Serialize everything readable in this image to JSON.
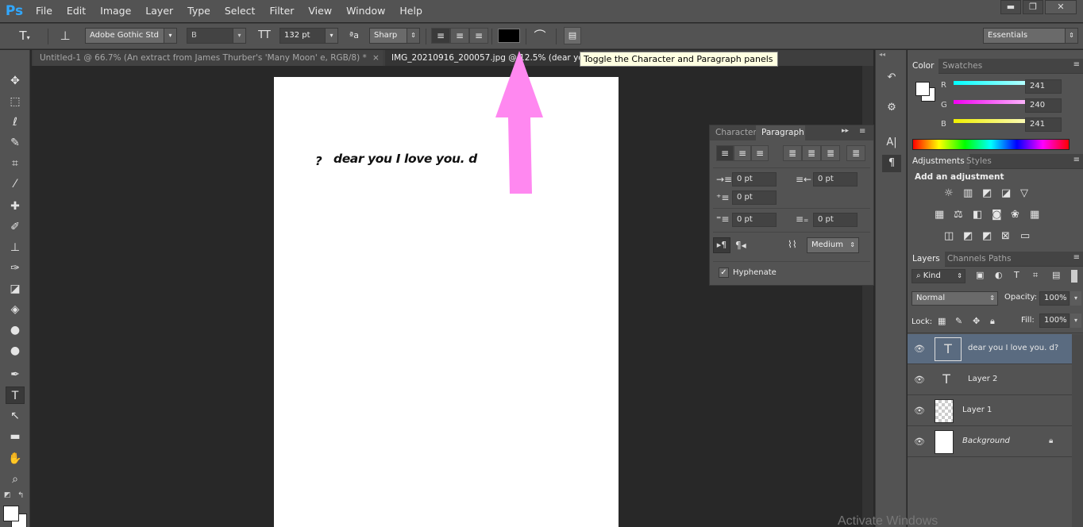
{
  "app": {
    "logo": "Ps"
  },
  "menu": [
    "File",
    "Edit",
    "Image",
    "Layer",
    "Type",
    "Select",
    "Filter",
    "View",
    "Window",
    "Help"
  ],
  "window_controls": {
    "minimize": "▬",
    "restore": "❐",
    "close": "✕"
  },
  "options_bar": {
    "font_family": "Adobe Gothic Std",
    "font_style": "B",
    "font_size": "132 pt",
    "anti_alias": "Sharp",
    "text_color": "#000000",
    "workspace": "Essentials"
  },
  "tabs": [
    {
      "label": "Untitled-1 @ 66.7% (An extract from James Thurber's 'Many Moon' e, RGB/8) *",
      "close": "×"
    },
    {
      "label": "IMG_20210916_200057.jpg @ 12.5% (dear you",
      "close": ""
    }
  ],
  "tooltip": "Toggle the Character and Paragraph panels",
  "document": {
    "text": "dear you I love you. d",
    "mark": "?"
  },
  "paragraph_panel": {
    "tabs": [
      "Character",
      "Paragraph"
    ],
    "indent_left": "0 pt",
    "indent_right": "0 pt",
    "indent_first": "0 pt",
    "space_before": "0 pt",
    "space_after": "0 pt",
    "composer": "Medium",
    "hyphenate_label": "Hyphenate",
    "hyphenate_checked": true
  },
  "color_panel": {
    "tabs": [
      "Color",
      "Swatches"
    ],
    "labels": [
      "R",
      "G",
      "B"
    ],
    "r": "241",
    "g": "240",
    "b": "241"
  },
  "adjustments_panel": {
    "tabs": [
      "Adjustments",
      "Styles"
    ],
    "heading": "Add an adjustment"
  },
  "layers_panel": {
    "tabs": [
      "Layers",
      "Channels",
      "Paths"
    ],
    "filter": "Kind",
    "blend_mode": "Normal",
    "opacity_label": "Opacity:",
    "opacity": "100%",
    "lock_label": "Lock:",
    "fill_label": "Fill:",
    "fill": "100%",
    "layers": [
      {
        "name": "dear you I love you. d?",
        "type": "text"
      },
      {
        "name": "Layer 2",
        "type": "text"
      },
      {
        "name": "Layer 1",
        "type": "transparent"
      },
      {
        "name": "Background",
        "type": "white"
      }
    ]
  },
  "watermark": "Activate Windows",
  "colors": {
    "accent": "#31a8ff",
    "arrow": "#ff88f0",
    "selected_layer": "#5a6b80"
  }
}
